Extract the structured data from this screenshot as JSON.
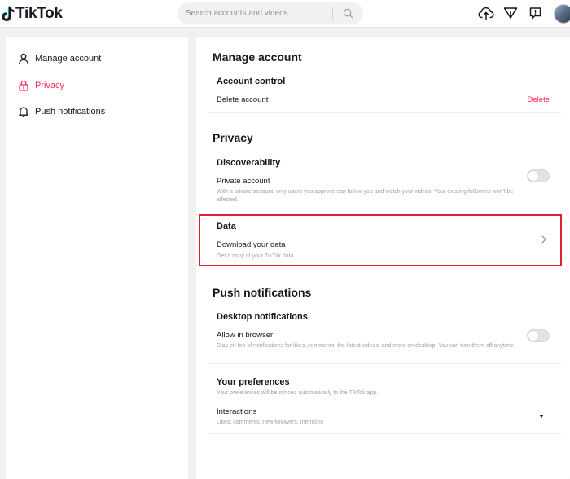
{
  "header": {
    "logo_text": "TikTok",
    "search": {
      "placeholder": "Search accounts and videos"
    },
    "icons": [
      "upload-icon",
      "inbox-filter-icon",
      "messages-icon",
      "avatar"
    ]
  },
  "sidebar": {
    "items": [
      {
        "label": "Manage account",
        "icon": "person-icon",
        "active": false
      },
      {
        "label": "Privacy",
        "icon": "lock-icon",
        "active": true
      },
      {
        "label": "Push notifications",
        "icon": "bell-icon",
        "active": false
      }
    ]
  },
  "colors": {
    "accent": "#fe2c55",
    "highlight": "#e0202f",
    "text": "#161823",
    "muted": "#a2a3a8"
  },
  "main": {
    "manage": {
      "title": "Manage account",
      "account_control": "Account control",
      "delete_account": "Delete account",
      "delete_link": "Delete"
    },
    "privacy": {
      "title": "Privacy",
      "discoverability": "Discoverability",
      "private_account": "Private account",
      "private_desc": "With a private account, only users you approve can follow you and watch your videos. Your existing followers won't be affected.",
      "private_enabled": false,
      "data_title": "Data",
      "download_data": "Download your data",
      "download_desc": "Get a copy of your TikTok data"
    },
    "push": {
      "title": "Push notifications",
      "desktop": "Desktop notifications",
      "allow_browser": "Allow in browser",
      "allow_desc": "Stay on top of notifications for likes, comments, the latest videos, and more on desktop. You can turn them off anytime.",
      "allow_enabled": false,
      "preferences": "Your preferences",
      "preferences_desc": "Your preferences will be synced automatically to the TikTok app.",
      "interactions": "Interactions",
      "interactions_desc": "Likes, comments, new followers, mentions"
    }
  }
}
